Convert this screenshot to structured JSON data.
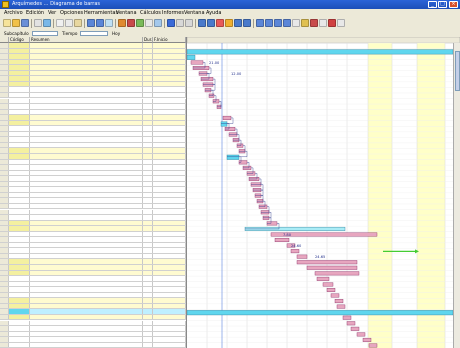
{
  "window": {
    "title_prefix": "Arquímedes",
    "title_visible_end": "Diagrama de barras",
    "buttons": [
      "_",
      "□",
      "×"
    ]
  },
  "menu": [
    "Archivo",
    "Edición",
    "Ver",
    "Opciones",
    "Herramientas",
    "Ventana",
    "Cálculos",
    "Informes",
    "Ventana",
    "Ayuda"
  ],
  "toolbar": {
    "subcapitulo_label": "Subcapítulo",
    "tiempo_label": "Tiempo",
    "hoy_label": "Hoy"
  },
  "grid": {
    "headers": [
      "",
      "Código",
      "Resumen",
      "Dur.",
      "F.Inicio"
    ]
  },
  "colors": {
    "accent_blue": "#3a6ad8",
    "highlight_yellow": "#f4f0a0",
    "bar_pink": "#e7a6bf",
    "bar_cyan": "#5fd6ee",
    "bar_lightcyan": "#a9ecf6",
    "milestone_green": "#44cc33",
    "panel_yellow": "#ffffc8"
  },
  "gantt_labels": [
    "21.00",
    "12.00",
    "7.80",
    "24.60",
    "24.65"
  ]
}
